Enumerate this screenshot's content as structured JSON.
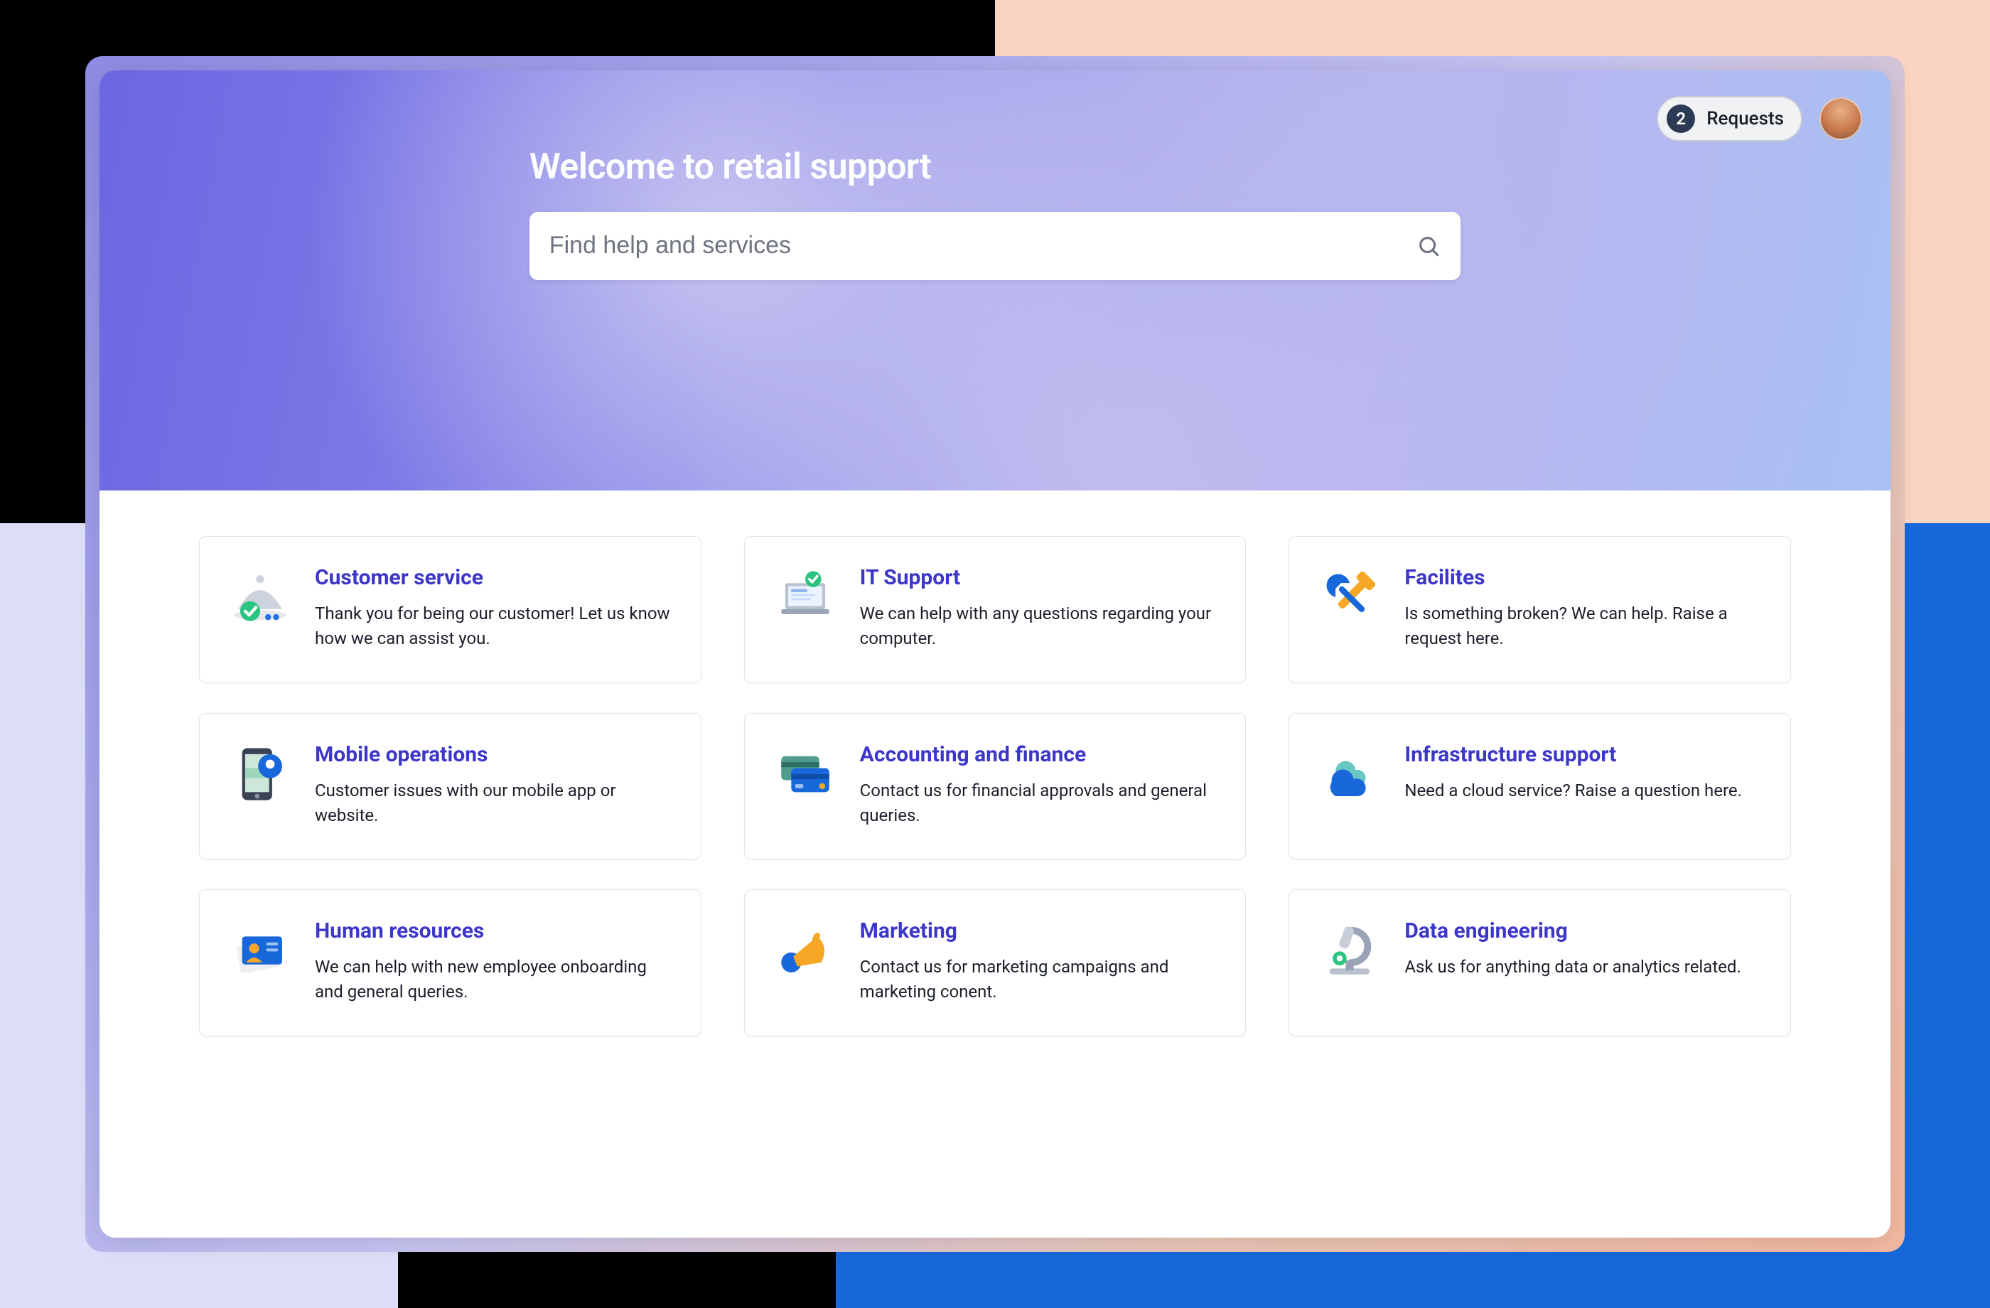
{
  "hero": {
    "title": "Welcome to retail support"
  },
  "search": {
    "placeholder": "Find help and services"
  },
  "header": {
    "requests_count": "2",
    "requests_label": "Requests"
  },
  "colors": {
    "accent": "#3C37C8",
    "hero_start": "#6B67E2",
    "hero_end": "#A9C0F2",
    "pill_bg": "#F1F2F4",
    "badge_bg": "#2B3A55"
  },
  "cards": [
    {
      "icon": "platter-check-icon",
      "title": "Customer service",
      "desc": "Thank you for being our customer! Let us know how we can assist you."
    },
    {
      "icon": "laptop-check-icon",
      "title": "IT Support",
      "desc": "We can help with any questions regarding your computer."
    },
    {
      "icon": "tools-icon",
      "title": "Facilites",
      "desc": "Is something broken? We can help. Raise a request here."
    },
    {
      "icon": "mobile-pin-icon",
      "title": "Mobile operations",
      "desc": "Customer issues with our mobile app or website."
    },
    {
      "icon": "credit-cards-icon",
      "title": "Accounting and finance",
      "desc": "Contact us for financial approvals and general queries."
    },
    {
      "icon": "cloud-icon",
      "title": "Infrastructure support",
      "desc": "Need a cloud service? Raise a question here."
    },
    {
      "icon": "id-card-icon",
      "title": "Human resources",
      "desc": "We can help with new employee onboarding and general queries."
    },
    {
      "icon": "megaphone-icon",
      "title": "Marketing",
      "desc": "Contact us for marketing campaigns and marketing conent."
    },
    {
      "icon": "microscope-icon",
      "title": "Data engineering",
      "desc": "Ask us for anything data or analytics related."
    }
  ]
}
